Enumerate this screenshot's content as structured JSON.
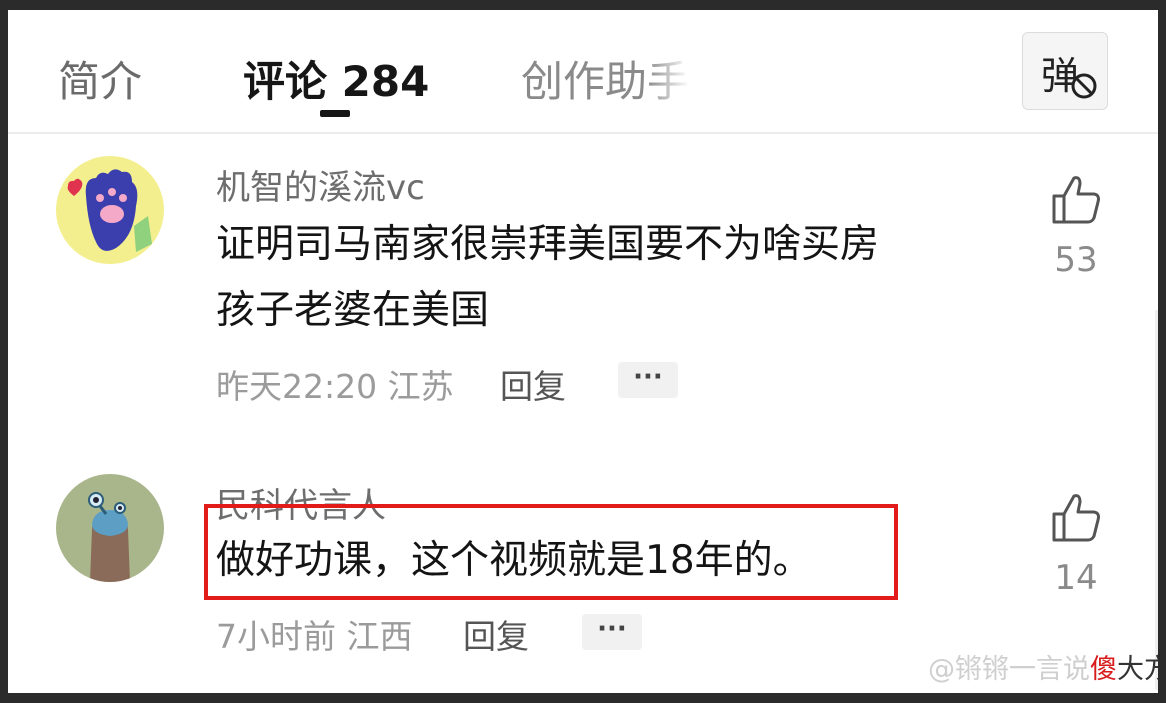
{
  "tabs": {
    "intro": "简介",
    "comments": "评论 284",
    "creator": "创作助手"
  },
  "danmaku_button": {
    "char": "弹",
    "icon": "danmaku-off-icon"
  },
  "comments": [
    {
      "username": "机智的溪流vc",
      "text_lines": [
        "证明司马南家很崇拜美国要不为啥买房",
        "孩子老婆在美国"
      ],
      "time": "昨天22:20",
      "location": "江苏",
      "reply": "回复",
      "more": "···",
      "likes": "53"
    },
    {
      "username": "民科代言人",
      "text_lines": [
        "做好功课，这个视频就是18年的。"
      ],
      "time": "7小时前",
      "location": "江西",
      "reply": "回复",
      "more": "···",
      "likes": "14"
    }
  ],
  "watermark": {
    "prefix": "@锵锵一言说",
    "red": "傻",
    "dark": "大方"
  },
  "colors": {
    "highlight": "#e21a1a",
    "text": "#141414",
    "meta": "#9b9b9b"
  }
}
